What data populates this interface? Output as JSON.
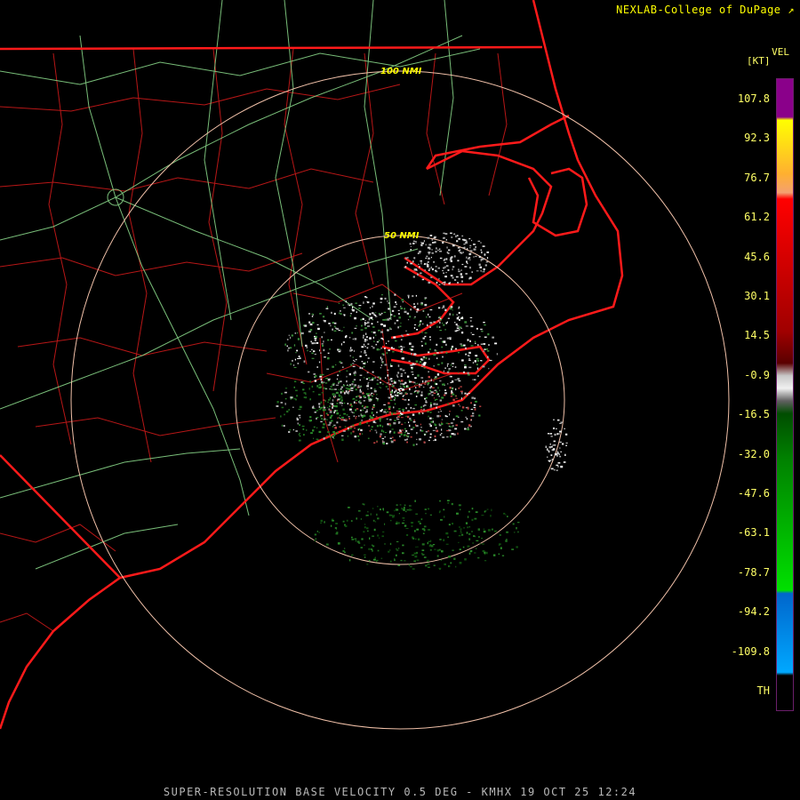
{
  "credit": "NEXLAB-College of DuPage",
  "credit_icon": "external-link-icon",
  "legend": {
    "product": "VEL",
    "unit": "[KT]",
    "ticks": [
      "107.8",
      "92.3",
      "76.7",
      "61.2",
      "45.6",
      "30.1",
      "14.5",
      "-0.9",
      "-16.5",
      "-32.0",
      "-47.6",
      "-63.1",
      "-78.7",
      "-94.2",
      "-109.8",
      "TH"
    ],
    "colors": {
      "purple": "#8a008a",
      "yellow": "#ffff00",
      "peach": "#f4a070",
      "red": "#ff0000",
      "dark_red": "#5a0000",
      "gray": "#c8c8c8",
      "dark_green": "#004d00",
      "green": "#00e000",
      "blue": "#0066cc",
      "cyan": "#00a8ff"
    }
  },
  "range_rings": [
    "50 NMI",
    "100 NMI"
  ],
  "caption": "SUPER-RESOLUTION BASE VELOCITY 0.5 DEG - KMHX 19 OCT 25 12:24"
}
